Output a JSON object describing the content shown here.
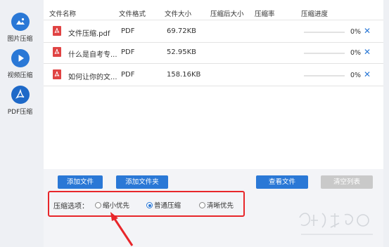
{
  "sidebar": {
    "items": [
      {
        "label": "图片压缩",
        "icon": "image-icon"
      },
      {
        "label": "视频压缩",
        "icon": "play-icon"
      },
      {
        "label": "PDF压缩",
        "icon": "pdf-icon",
        "active": true
      }
    ]
  },
  "table": {
    "headers": [
      "文件名称",
      "文件格式",
      "文件大小",
      "压缩后大小",
      "压缩率",
      "压缩进度"
    ],
    "rows": [
      {
        "name": "文件压缩.pdf",
        "format": "PDF",
        "size": "69.72KB",
        "compressed": "",
        "ratio": "",
        "progress": 0,
        "progress_text": "0%"
      },
      {
        "name": "什么是自考专...",
        "format": "PDF",
        "size": "52.95KB",
        "compressed": "",
        "ratio": "",
        "progress": 0,
        "progress_text": "0%"
      },
      {
        "name": "如何让你的文...",
        "format": "PDF",
        "size": "158.16KB",
        "compressed": "",
        "ratio": "",
        "progress": 0,
        "progress_text": "0%"
      }
    ],
    "remove_glyph": "✕"
  },
  "toolbar": {
    "add_file": "添加文件",
    "add_folder": "添加文件夹",
    "view_files": "查看文件",
    "clear_list": "清空列表"
  },
  "options": {
    "label": "压缩选项：",
    "choices": [
      {
        "label": "缩小优先",
        "checked": false
      },
      {
        "label": "普通压缩",
        "checked": true
      },
      {
        "label": "清晰优先",
        "checked": false
      }
    ]
  },
  "colors": {
    "accent": "#2a78d6",
    "highlight": "#e8262a",
    "pdf_red": "#e04343"
  }
}
